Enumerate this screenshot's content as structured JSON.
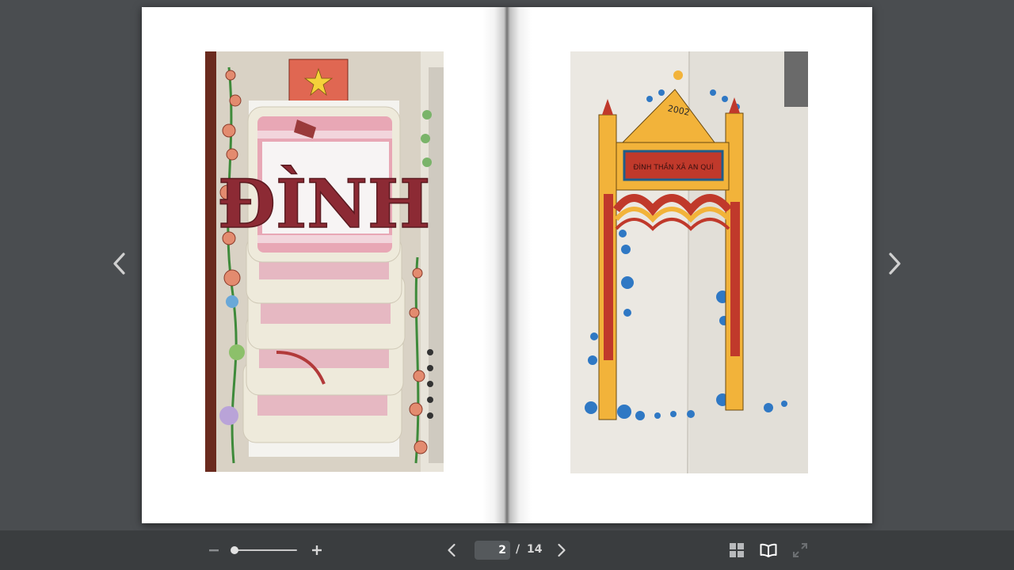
{
  "viewer": {
    "current_page": "2",
    "page_separator": "/",
    "total_pages": "14",
    "zoom_level": 0
  },
  "icons": {
    "side_prev": "chevron-left-icon",
    "side_next": "chevron-right-icon",
    "zoom_out": "minus-icon",
    "zoom_in": "plus-icon",
    "prev": "chevron-left-icon",
    "next": "chevron-right-icon",
    "thumbnails": "grid-icon",
    "book_view": "open-book-icon",
    "fullscreen": "expand-icon"
  },
  "colors": {
    "background": "#4a4d50",
    "toolbar": "#3a3d3f",
    "page": "#ffffff",
    "icon": "#d6d6d6",
    "icon_disabled": "#8a8d90"
  },
  "pages": {
    "left": {
      "image_text": "ĐÌNH"
    },
    "right": {
      "image_text_year": "2002",
      "image_text_banner": "ĐÌNH THẦN XÃ AN QUÍ"
    }
  }
}
